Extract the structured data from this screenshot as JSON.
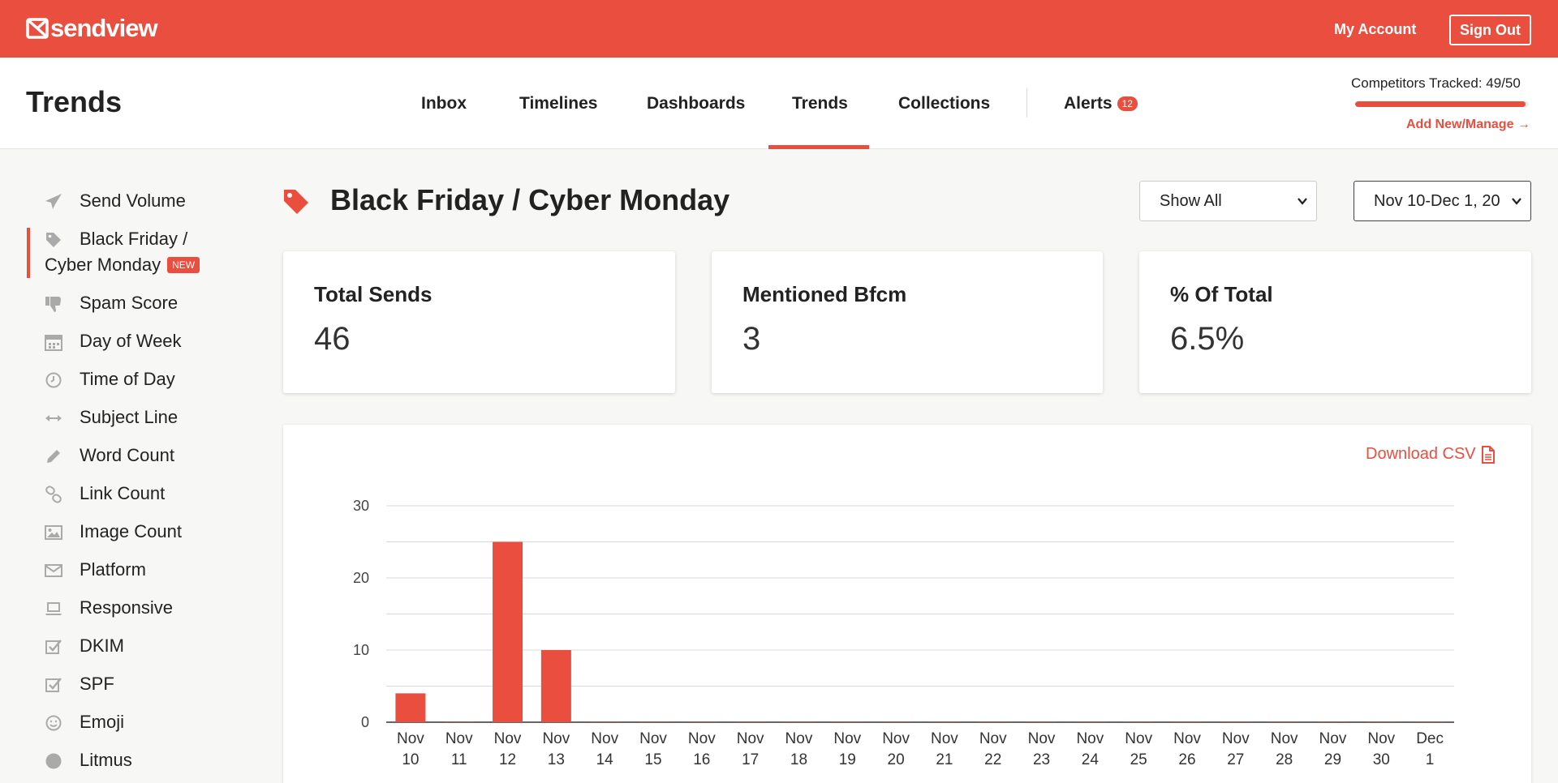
{
  "brand": {
    "name": "sendview",
    "accent": "#e94e3f"
  },
  "topbar": {
    "my_account": "My Account",
    "sign_out": "Sign Out"
  },
  "page": {
    "title": "Trends"
  },
  "nav": {
    "items": [
      "Inbox",
      "Timelines",
      "Dashboards",
      "Trends",
      "Collections"
    ],
    "active": "Trends",
    "alerts_label": "Alerts",
    "alerts_count": "12"
  },
  "tracked": {
    "label": "Competitors Tracked: 49/50",
    "fraction": 0.98,
    "link": "Add New/Manage →"
  },
  "sidebar": {
    "items": [
      {
        "label": "Send Volume",
        "icon": "paper-plane-icon"
      },
      {
        "label": "Black Friday /",
        "label2": "Cyber Monday",
        "badge": "NEW",
        "icon": "tag-icon",
        "active": true
      },
      {
        "label": "Spam Score",
        "icon": "thumbs-down-icon"
      },
      {
        "label": "Day of Week",
        "icon": "calendar-icon"
      },
      {
        "label": "Time of Day",
        "icon": "clock-icon"
      },
      {
        "label": "Subject Line",
        "icon": "arrows-horizontal-icon"
      },
      {
        "label": "Word Count",
        "icon": "pencil-icon"
      },
      {
        "label": "Link Count",
        "icon": "link-icon"
      },
      {
        "label": "Image Count",
        "icon": "image-icon"
      },
      {
        "label": "Platform",
        "icon": "envelope-icon"
      },
      {
        "label": "Responsive",
        "icon": "laptop-icon"
      },
      {
        "label": "DKIM",
        "icon": "checkbox-icon"
      },
      {
        "label": "SPF",
        "icon": "checkbox-icon"
      },
      {
        "label": "Emoji",
        "icon": "smile-icon"
      },
      {
        "label": "Litmus",
        "icon": "circle-icon"
      }
    ]
  },
  "section": {
    "title": "Black Friday / Cyber Monday",
    "filter_value": "Show All",
    "date_value": "Nov 10-Dec 1, 20"
  },
  "stats": [
    {
      "label": "Total Sends",
      "value": "46"
    },
    {
      "label": "Mentioned Bfcm",
      "value": "3"
    },
    {
      "label": "% Of Total",
      "value": "6.5%"
    }
  ],
  "download_label": "Download CSV",
  "chart_data": {
    "type": "bar",
    "categories": [
      "Nov 10",
      "Nov 11",
      "Nov 12",
      "Nov 13",
      "Nov 14",
      "Nov 15",
      "Nov 16",
      "Nov 17",
      "Nov 18",
      "Nov 19",
      "Nov 20",
      "Nov 21",
      "Nov 22",
      "Nov 23",
      "Nov 24",
      "Nov 25",
      "Nov 26",
      "Nov 27",
      "Nov 28",
      "Nov 29",
      "Nov 30",
      "Dec 1"
    ],
    "values": [
      4,
      0,
      25,
      10,
      0,
      0,
      0,
      0,
      0,
      0,
      0,
      0,
      0,
      0,
      0,
      0,
      0,
      0,
      0,
      0,
      0,
      0
    ],
    "yticks": [
      0,
      10,
      20,
      30
    ],
    "ylim": [
      0,
      30
    ],
    "grid": true,
    "bar_color": "#e94e3f"
  }
}
